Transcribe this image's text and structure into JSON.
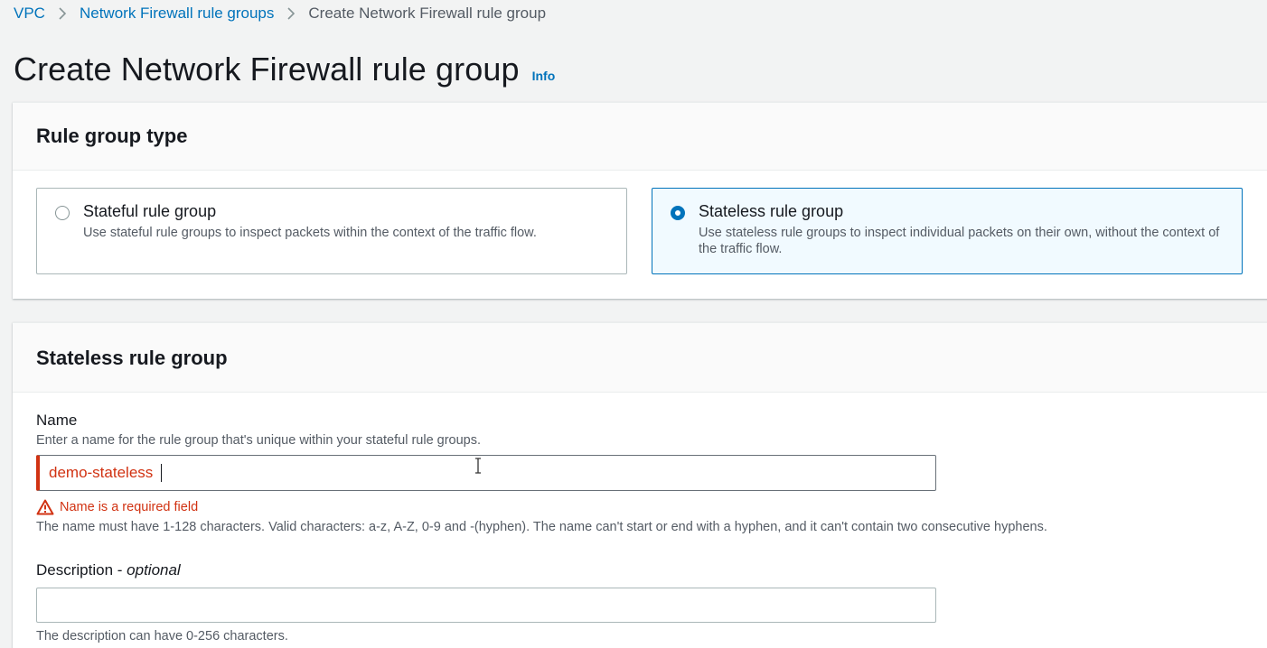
{
  "breadcrumb": {
    "items": [
      "VPC",
      "Network Firewall rule groups",
      "Create Network Firewall rule group"
    ]
  },
  "header": {
    "title": "Create Network Firewall rule group",
    "info": "Info"
  },
  "rule_group_type": {
    "title": "Rule group type",
    "options": [
      {
        "label": "Stateful rule group",
        "description": "Use stateful rule groups to inspect packets within the context of the traffic flow.",
        "selected": false
      },
      {
        "label": "Stateless rule group",
        "description": "Use stateless rule groups to inspect individual packets on their own, without the context of the traffic flow.",
        "selected": true
      }
    ]
  },
  "stateless_section": {
    "title": "Stateless rule group",
    "name": {
      "label": "Name",
      "description": "Enter a name for the rule group that's unique within your stateful rule groups.",
      "value": "demo-stateless",
      "error": "Name is a required field",
      "constraint": "The name must have 1-128 characters. Valid characters: a-z, A-Z, 0-9 and -(hyphen). The name can't start or end with a hyphen, and it can't contain two consecutive hyphens."
    },
    "description": {
      "label": "Description",
      "label_suffix": "optional",
      "separator": " - ",
      "value": "",
      "constraint": "The description can have 0-256 characters."
    }
  },
  "colors": {
    "link": "#0073bb",
    "error": "#d13212",
    "selected_bg": "#f1faff",
    "page_bg": "#f2f3f3"
  },
  "icons": {
    "breadcrumb_separator": "chevron-right-icon",
    "error": "warning-icon"
  }
}
